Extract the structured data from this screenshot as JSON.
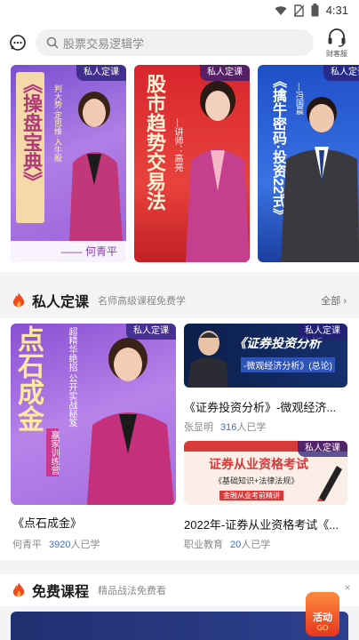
{
  "status_bar": {
    "time": "4:31"
  },
  "search": {
    "placeholder": "股票交易逻辑学"
  },
  "service": {
    "label": "财客服"
  },
  "banners": [
    {
      "badge": "私人定课",
      "title": "《操盘宝典》",
      "tagline": "判大势·定思维·入牛股",
      "teacher": "—— 何青平"
    },
    {
      "badge": "私人定课",
      "title": "股市趋势交易法",
      "tagline": "—讲师：高亮"
    },
    {
      "badge": "私人定课",
      "title": "《擒牛密码·投资22式》",
      "tagline": "—冯国晨"
    }
  ],
  "private_section": {
    "title": "私人定课",
    "subtitle": "名师高级课程免费学",
    "more": "全部 ›"
  },
  "courses": [
    {
      "badge": "私人定课",
      "cover_title": "点石成金",
      "cover_sub": "赢家训练营",
      "cover_side": "超精华绝招 公开实战秘笈",
      "title": "《点石成金》",
      "teacher": "何青平",
      "count": "3920",
      "count_suffix": "人已学"
    },
    {
      "badge": "私人定课",
      "cover_title": "《证券投资分析",
      "cover_sub": "-微观经济分析》(总论)",
      "title": "《证券投资分析》-微观经济...",
      "teacher": "张显明",
      "count": "316",
      "count_suffix": "人已学"
    },
    {
      "badge": "私人定课",
      "cover_title": "证券从业资格考试",
      "cover_sub": "《基础知识+法律法规》",
      "cover_side": "金融从业考前精讲",
      "title": "2022年-证券从业资格考试《...",
      "teacher": "职业教育",
      "count": "20",
      "count_suffix": "人已学"
    }
  ],
  "free_section": {
    "title": "免费课程",
    "subtitle": "精品战法免费看"
  },
  "float_promo": {
    "label": "活动",
    "sub": "GO"
  },
  "colors": {
    "accent_blue": "#3c6ee0",
    "badge_purple": "#5b3fa8",
    "fire_red": "#f04a1c"
  }
}
